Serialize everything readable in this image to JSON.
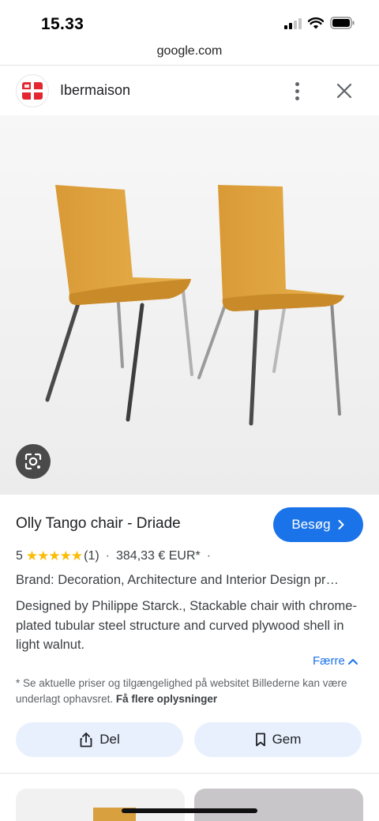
{
  "status_bar": {
    "time": "15.33"
  },
  "browser": {
    "url": "google.com"
  },
  "source": {
    "site_name": "Ibermaison"
  },
  "product": {
    "title": "Olly Tango chair - Driade",
    "visit_label": "Besøg",
    "rating_value": "5",
    "stars": "★★★★★",
    "review_count": "(1)",
    "separator": "·",
    "price": "384,33 € EUR*",
    "brand_line": "Brand: Decoration, Architecture and Interior Design pr…",
    "description": "Designed by Philippe Starck., Stackable chair with chrome-plated tubular steel structure and curved plywood shell in light walnut.",
    "fewer_label": "Færre"
  },
  "disclaimer": {
    "text": "* Se aktuelle priser og tilgængelighed på websitet Billederne kan være underlagt ophavsret.",
    "link": "Få flere oplysninger"
  },
  "actions": {
    "share_label": "Del",
    "save_label": "Gem"
  },
  "colors": {
    "accent": "#1a73e8",
    "star": "#fbbc04",
    "button_bg": "#e8f0fe",
    "logo_red": "#e3262f"
  },
  "icons": [
    "signal-icon",
    "wifi-icon",
    "battery-icon",
    "site-logo-icon",
    "more-vert-icon",
    "close-icon",
    "google-lens-icon",
    "chevron-right-icon",
    "chevron-up-icon",
    "share-icon",
    "bookmark-icon"
  ]
}
